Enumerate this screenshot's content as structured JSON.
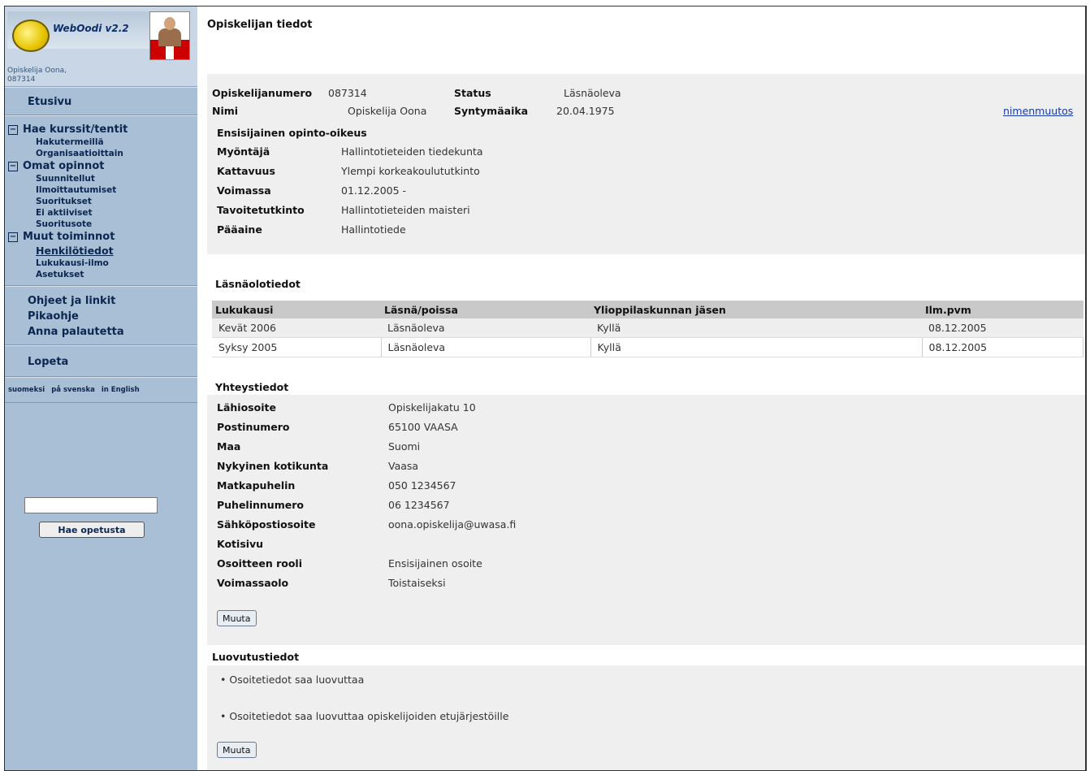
{
  "sidebar": {
    "logo_text": "WebOodi v2.2",
    "user_line1": "Opiskelija Oona,",
    "user_line2": "087314",
    "home": "Etusivu",
    "groups": [
      {
        "title": "Hae kurssit/tentit",
        "items": [
          "Hakutermeillä",
          "Organisaatioittain"
        ]
      },
      {
        "title": "Omat opinnot",
        "items": [
          "Suunnitellut",
          "Ilmoittautumiset",
          "Suoritukset",
          "Ei aktiiviset",
          "Suoritusote"
        ]
      },
      {
        "title": "Muut toiminnot",
        "items": [
          "Henkilötiedot",
          "Lukukausi-ilmo",
          "Asetukset"
        ]
      }
    ],
    "help": [
      "Ohjeet ja linkit",
      "Pikaohje",
      "Anna palautetta"
    ],
    "logout": "Lopeta",
    "languages": [
      "suomeksi",
      "på svenska",
      "in English"
    ],
    "search_value": "",
    "search_button": "Hae opetusta"
  },
  "main": {
    "title": "Opiskelijan tiedot",
    "basic": {
      "student_no_label": "Opiskelijanumero",
      "student_no": "087314",
      "status_label": "Status",
      "status": "Läsnäoleva",
      "name_label": "Nimi",
      "name": "Opiskelija Oona",
      "birth_label": "Syntymäaika",
      "birth": "20.04.1975",
      "rename_link": "nimenmuutos"
    },
    "right": {
      "title": "Ensisijainen opinto-oikeus",
      "rows": [
        {
          "label": "Myöntäjä",
          "value": "Hallintotieteiden tiedekunta"
        },
        {
          "label": "Kattavuus",
          "value": "Ylempi korkeakoulututkinto"
        },
        {
          "label": "Voimassa",
          "value": "01.12.2005 -"
        },
        {
          "label": "Tavoitetutkinto",
          "value": "Hallintotieteiden maisteri"
        },
        {
          "label": "Pääaine",
          "value": "Hallintotiede"
        }
      ]
    },
    "attendance": {
      "title": "Läsnäolotiedot",
      "headers": [
        "Lukukausi",
        "Läsnä/poissa",
        "Ylioppilaskunnan jäsen",
        "Ilm.pvm"
      ],
      "rows": [
        [
          "Kevät 2006",
          "Läsnäoleva",
          "Kyllä",
          "08.12.2005"
        ],
        [
          "Syksy 2005",
          "Läsnäoleva",
          "Kyllä",
          "08.12.2005"
        ]
      ]
    },
    "contact": {
      "title": "Yhteystiedot",
      "rows": [
        {
          "label": "Lähiosoite",
          "value": "Opiskelijakatu 10"
        },
        {
          "label": "Postinumero",
          "value": "65100 VAASA"
        },
        {
          "label": "Maa",
          "value": "Suomi"
        },
        {
          "label": "Nykyinen kotikunta",
          "value": "Vaasa"
        },
        {
          "label": "Matkapuhelin",
          "value": "050 1234567"
        },
        {
          "label": "Puhelinnumero",
          "value": "06 1234567"
        },
        {
          "label": "Sähköpostiosoite",
          "value": "oona.opiskelija@uwasa.fi"
        },
        {
          "label": "Kotisivu",
          "value": ""
        },
        {
          "label": "Osoitteen rooli",
          "value": "Ensisijainen osoite"
        },
        {
          "label": "Voimassaolo",
          "value": "Toistaiseksi"
        }
      ],
      "button": "Muuta"
    },
    "disclosure": {
      "title": "Luovutustiedot",
      "items": [
        "Osoitetiedot saa luovuttaa",
        "Osoitetiedot saa luovuttaa opiskelijoiden etujärjestöille"
      ],
      "button": "Muuta"
    }
  }
}
